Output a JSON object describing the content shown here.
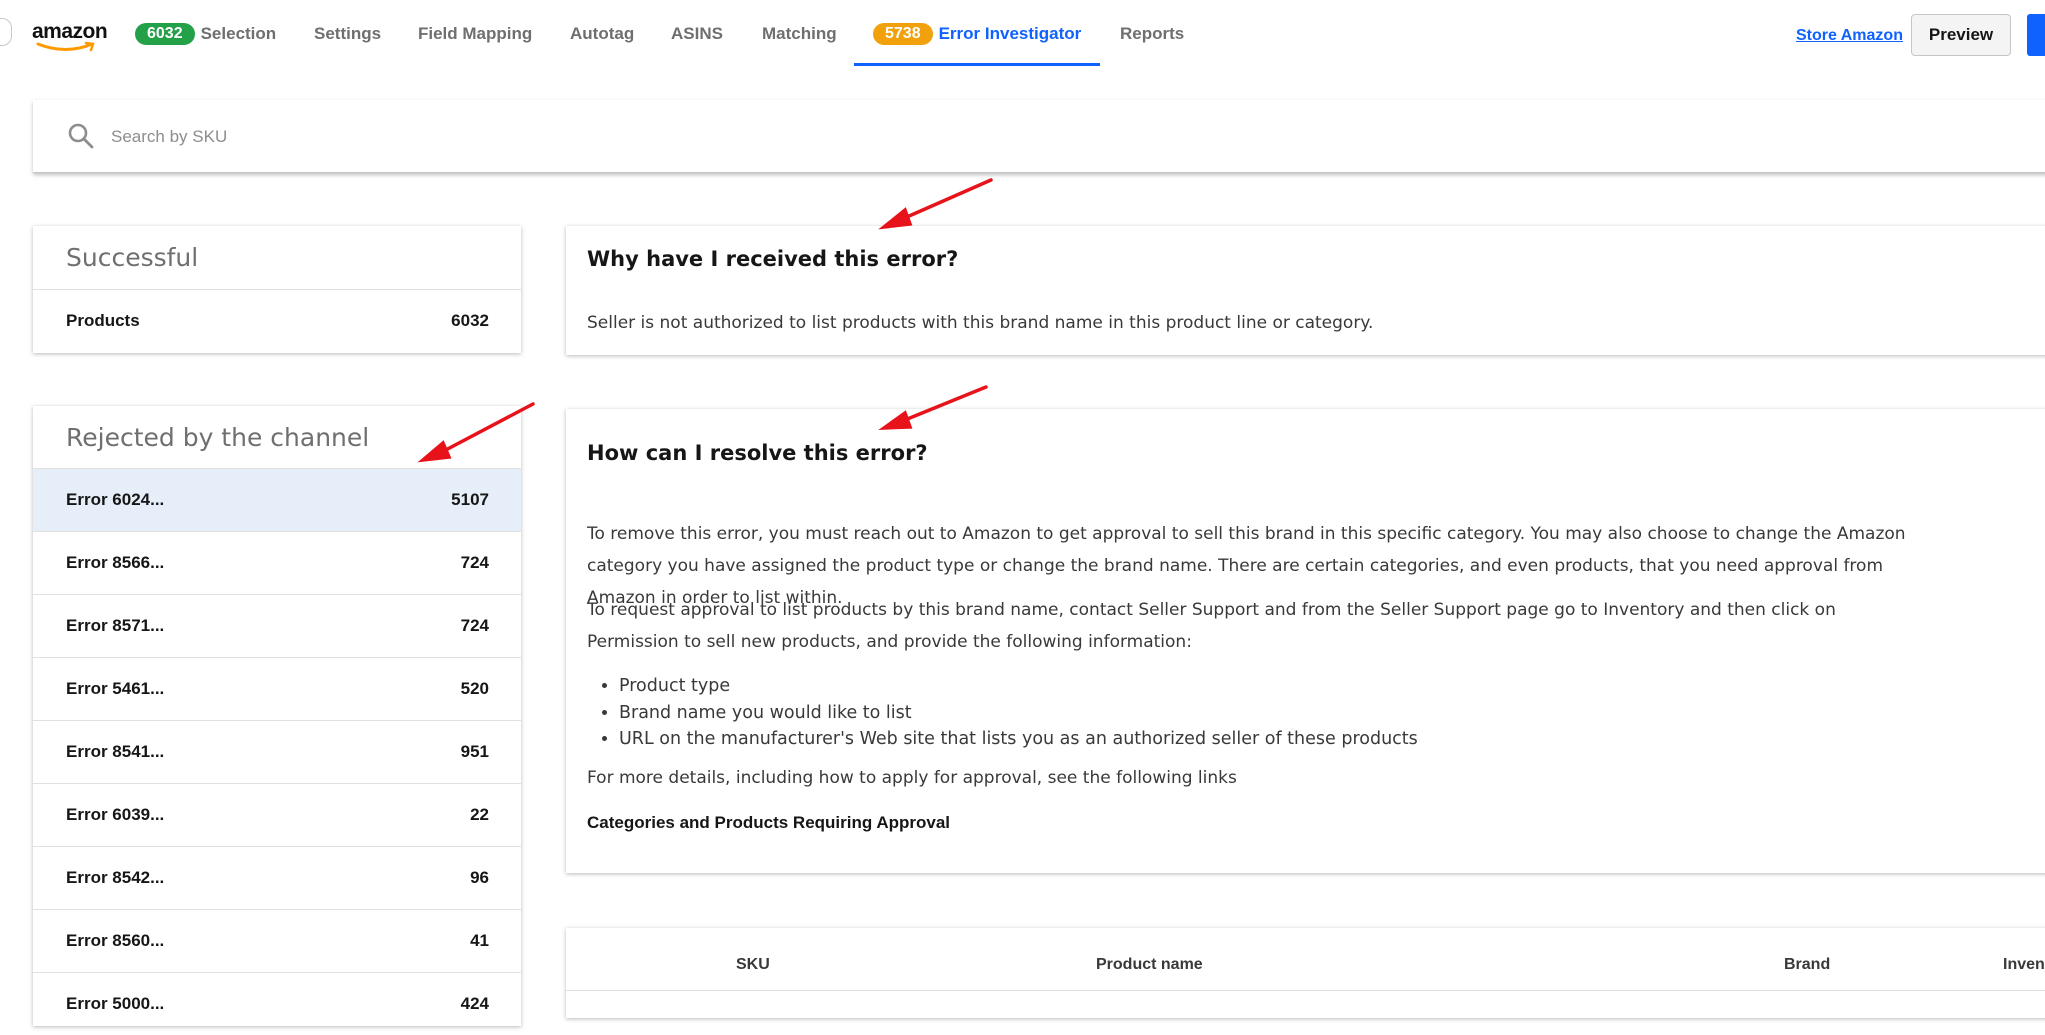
{
  "nav": {
    "logo_text": "amazon",
    "items": [
      {
        "label": "Selection",
        "badge": "6032"
      },
      {
        "label": "Settings"
      },
      {
        "label": "Field Mapping"
      },
      {
        "label": "Autotag"
      },
      {
        "label": "ASINS"
      },
      {
        "label": "Matching"
      },
      {
        "label": "Error Investigator",
        "badge": "5738"
      },
      {
        "label": "Reports"
      }
    ],
    "store_link": "Store Amazon",
    "preview_button": "Preview"
  },
  "search": {
    "placeholder": "Search by SKU"
  },
  "successful": {
    "title": "Successful",
    "rows": [
      {
        "label": "Products",
        "count": "6032"
      }
    ]
  },
  "rejected": {
    "title": "Rejected by the channel",
    "rows": [
      {
        "label": "Error 6024...",
        "count": "5107"
      },
      {
        "label": "Error 8566...",
        "count": "724"
      },
      {
        "label": "Error 8571...",
        "count": "724"
      },
      {
        "label": "Error 5461...",
        "count": "520"
      },
      {
        "label": "Error 8541...",
        "count": "951"
      },
      {
        "label": "Error 6039...",
        "count": "22"
      },
      {
        "label": "Error 8542...",
        "count": "96"
      },
      {
        "label": "Error 8560...",
        "count": "41"
      },
      {
        "label": "Error 5000...",
        "count": "424"
      }
    ]
  },
  "why": {
    "title": "Why have I received this error?",
    "text": "Seller is not authorized to list products with this brand name in this product line or category."
  },
  "resolve": {
    "title": "How can I resolve this error?",
    "para1": "To remove this error, you must reach out to Amazon to get approval to sell this brand in this specific category. You may also choose to change the Amazon category you have assigned the product type or change the brand name. There are certain categories, and even products, that you need approval from Amazon in order to list within.",
    "para2": "To request approval to list products by this brand name, contact Seller Support and from the Seller Support page go to Inventory and then click on Permission to sell new products, and provide the following information:",
    "bullets": [
      "Product type",
      "Brand name you would like to list",
      "URL on the manufacturer's Web site that lists you as an authorized seller of these products"
    ],
    "para3": "For more details, including how to apply for approval, see the following links",
    "link": "Categories and Products Requiring Approval"
  },
  "table": {
    "columns": [
      "SKU",
      "Product name",
      "Brand",
      "Inven"
    ]
  },
  "colors": {
    "accent": "#0f62fe",
    "badge_green": "#24a148",
    "badge_orange": "#f1a10c",
    "annotation_arrow": "#e8121b",
    "selected_row": "#e5eef9"
  }
}
